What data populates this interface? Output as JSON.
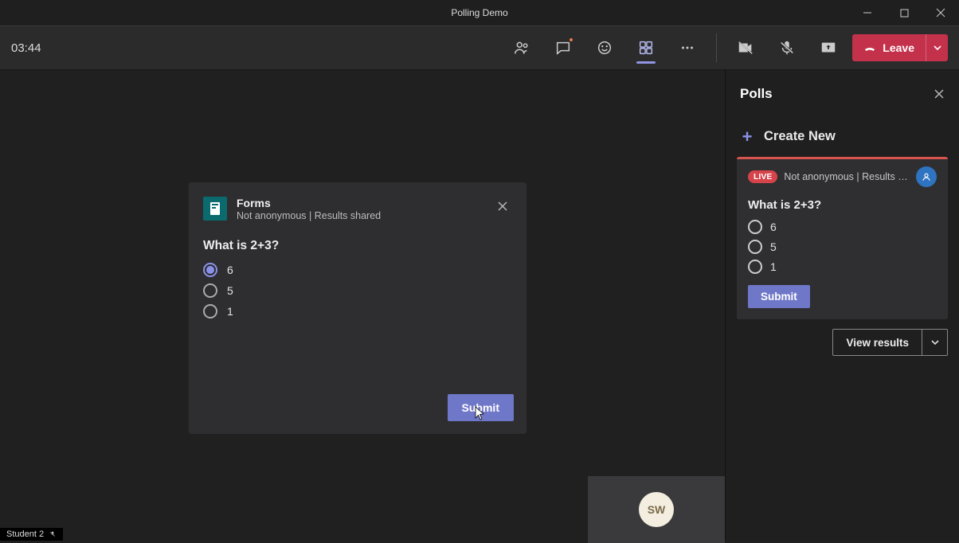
{
  "titlebar": {
    "title": "Polling Demo"
  },
  "toolbar": {
    "timer": "03:44",
    "leave_label": "Leave"
  },
  "poll_dialog": {
    "app_name": "Forms",
    "subtitle": "Not anonymous | Results shared",
    "question": "What is 2+3?",
    "options": [
      "6",
      "5",
      "1"
    ],
    "selected_index": 0,
    "submit_label": "Submit"
  },
  "participant": {
    "initials": "SW",
    "local_name": "Student 2"
  },
  "polls_panel": {
    "title": "Polls",
    "create_label": "Create New",
    "card": {
      "live_label": "LIVE",
      "meta": "Not anonymous | Results …",
      "question": "What is 2+3?",
      "options": [
        "6",
        "5",
        "1"
      ],
      "submit_label": "Submit",
      "view_results_label": "View results"
    }
  }
}
